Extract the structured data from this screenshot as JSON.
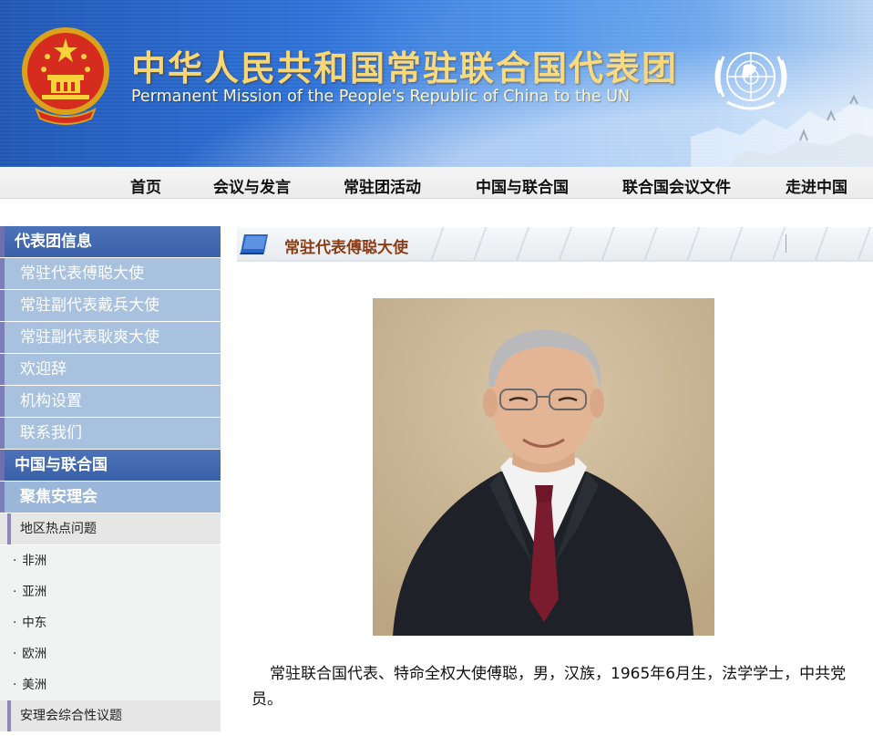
{
  "header": {
    "title_cn": "中华人民共和国常驻联合国代表团",
    "title_en": "Permanent Mission of the People's Republic of China to the UN",
    "emblem_icon": "national-emblem-icon",
    "un_icon": "un-emblem-icon"
  },
  "nav": {
    "items": [
      "首页",
      "会议与发言",
      "常驻团活动",
      "中国与联合国",
      "联合国会议文件",
      "走进中国"
    ]
  },
  "sidebar": {
    "section1": "代表团信息",
    "items1": [
      "常驻代表傅聪大使",
      "常驻副代表戴兵大使",
      "常驻副代表耿爽大使",
      "欢迎辞",
      "机构设置",
      "联系我们"
    ],
    "section2": "中国与联合国",
    "focus": "聚焦安理会",
    "sub1": "地区热点问题",
    "regions": [
      "非洲",
      "亚洲",
      "中东",
      "欧洲",
      "美洲"
    ],
    "region_bullet": "·",
    "sub2": "安理会综合性议题"
  },
  "main": {
    "section_title": "常驻代表傅聪大使",
    "bio": "常驻联合国代表、特命全权大使傅聪，男，汉族，1965年6月生，法学学士，中共党员。"
  },
  "colors": {
    "banner_blue": "#2d72d8",
    "title_gold": "#f7d774",
    "sidebar_head": "#3a60a8",
    "sidebar_item": "#a7c1de",
    "section_title": "#8a3d14"
  }
}
